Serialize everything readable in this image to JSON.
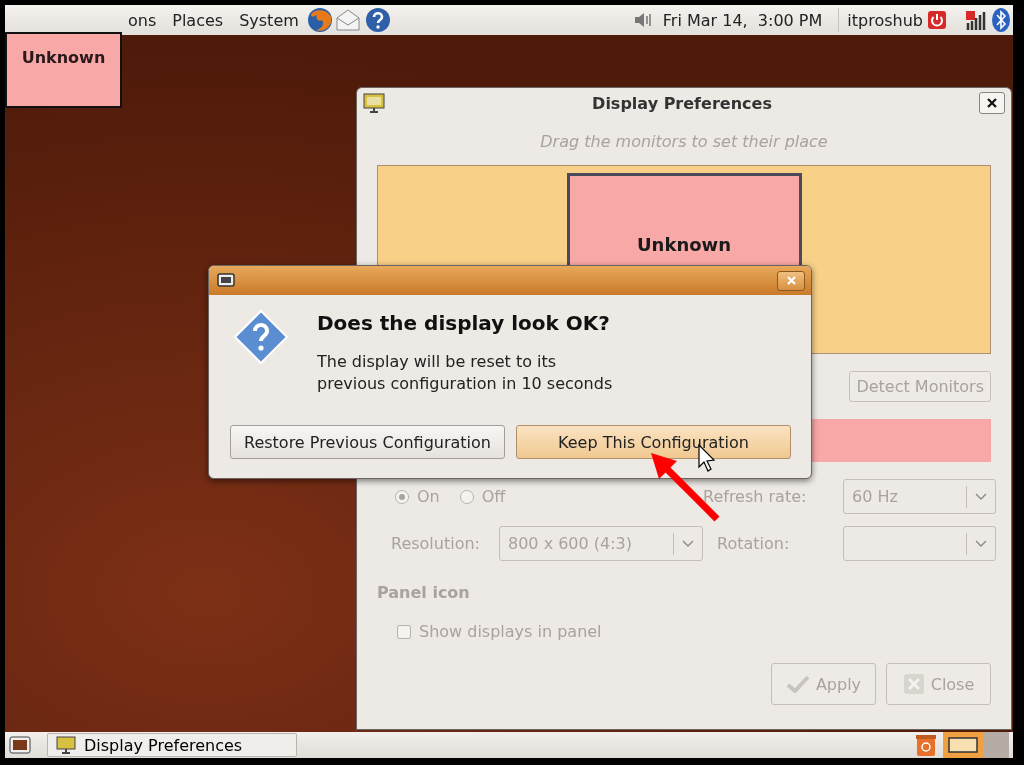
{
  "top_panel": {
    "menus": [
      "ons",
      "Places",
      "System"
    ],
    "clock": "Fri Mar 14,  3:00 PM",
    "user": "itproshub"
  },
  "monitor_label": {
    "text": "Unknown",
    "color": "#f9a8a8"
  },
  "prefs_window": {
    "title": "Display Preferences",
    "hint": "Drag the monitors to set their place",
    "monitor": {
      "label": "Unknown",
      "color": "#f9a8a8"
    },
    "detect_button": "Detect Monitors",
    "power": [
      {
        "label": "On",
        "selected": true
      },
      {
        "label": "Off",
        "selected": false
      }
    ],
    "refresh_label": "Refresh rate:",
    "refresh_value": "60 Hz",
    "resolution_label": "Resolution:",
    "resolution_value": "800 x 600 (4:3)",
    "rotation_label": "Rotation:",
    "panel_heading": "Panel icon",
    "show_in_panel": {
      "label": "Show displays in panel",
      "checked": false
    },
    "buttons": [
      "Apply",
      "Close"
    ],
    "disabled": true
  },
  "confirm_dialog": {
    "heading": "Does the display look OK?",
    "message_lines": [
      "The display will be reset to its",
      "previous configuration in 10 seconds"
    ],
    "buttons": [
      {
        "label": "Restore Previous Configuration",
        "highlighted": false
      },
      {
        "label": "Keep This Configuration",
        "highlighted": true
      }
    ]
  },
  "taskbar": {
    "tasks": [
      {
        "label": "Display Preferences"
      }
    ]
  }
}
